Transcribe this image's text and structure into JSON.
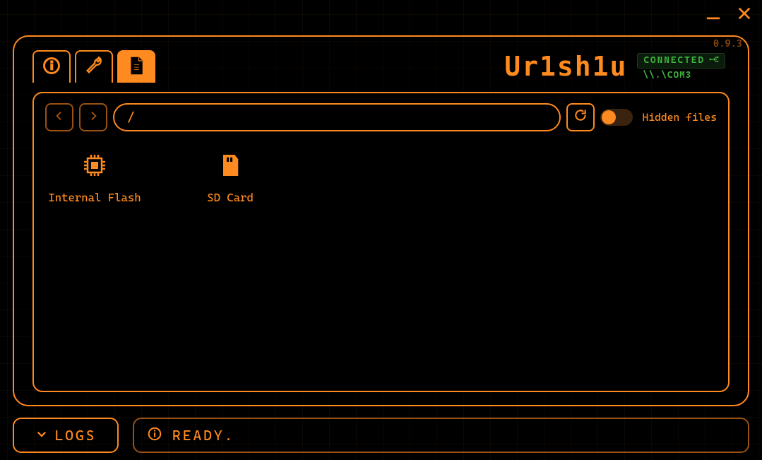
{
  "version": "0.9.3",
  "logo": "Ur1sh1u",
  "connection": {
    "status_label": "CONNECTED",
    "port": "\\\\.\\COM3"
  },
  "toolbar": {
    "path": "/",
    "hidden_files_label": "Hidden files",
    "hidden_files_on": false
  },
  "files": [
    {
      "name": "Internal Flash",
      "icon": "cpu"
    },
    {
      "name": "SD Card",
      "icon": "sd"
    }
  ],
  "footer": {
    "logs_label": "LOGS",
    "status_text": "READY."
  }
}
